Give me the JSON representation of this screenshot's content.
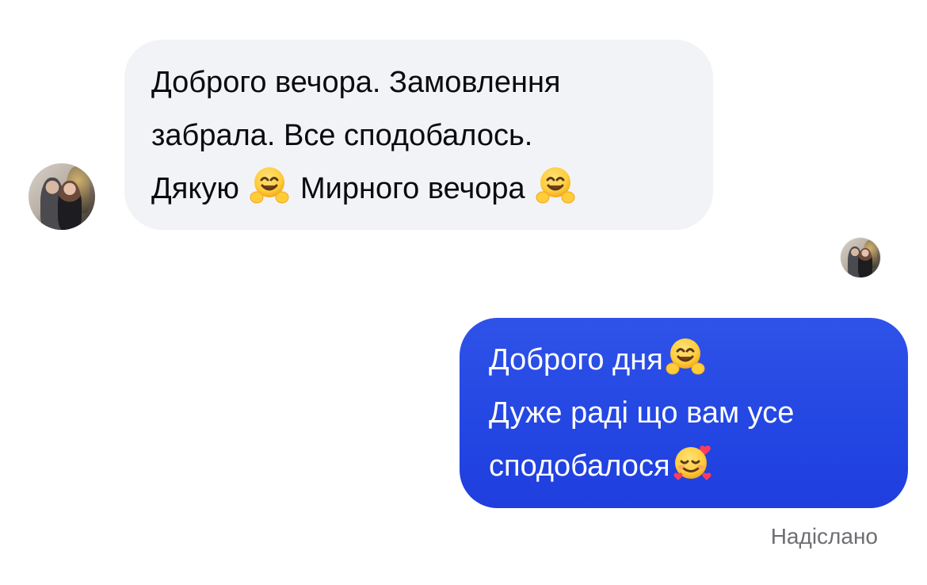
{
  "incoming": {
    "lines": {
      "line1": "Доброго вечора. Замовлення",
      "line2": "забрала. Все сподобалось.",
      "line3_start": "Дякую",
      "line3_middle": "Мирного вечора"
    }
  },
  "outgoing": {
    "lines": {
      "line1": "Доброго дня",
      "line2": "Дуже раді що вам усе",
      "line3": "сподобалося"
    },
    "status": "Надіслано"
  },
  "icons": {
    "hugging": "hugging-face-emoji",
    "smiling_hearts": "smiling-face-with-hearts-emoji"
  },
  "colors": {
    "incoming_bubble": "#f2f3f7",
    "outgoing_bubble": "#2447e3",
    "status_text": "#6e6e73"
  }
}
